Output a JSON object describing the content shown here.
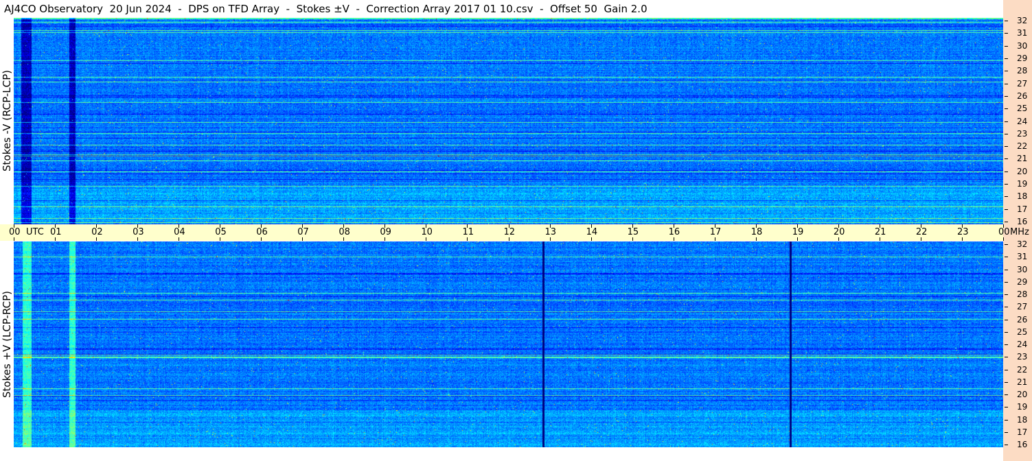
{
  "title": "AJ4CO Observatory  20 Jun 2024  -  DPS on TFD Array  -  Stokes ±V  -  Correction Array 2017 01 10.csv  -  Offset 50  Gain 2.0",
  "panels": {
    "top_label": "Stokes -V (RCP-LCP)",
    "bottom_label": "Stokes +V (LCP-RCP)"
  },
  "time_axis": {
    "utc_label": "UTC",
    "mhz_label": "MHz",
    "hours": [
      "00",
      "01",
      "02",
      "03",
      "04",
      "05",
      "06",
      "07",
      "08",
      "09",
      "10",
      "11",
      "12",
      "13",
      "14",
      "15",
      "16",
      "17",
      "18",
      "19",
      "20",
      "21",
      "22",
      "23",
      "00"
    ]
  },
  "freq_axis": {
    "ticks": [
      "32",
      "31",
      "30",
      "29",
      "28",
      "27",
      "26",
      "25",
      "24",
      "23",
      "22",
      "21",
      "20",
      "19",
      "18",
      "17",
      "16"
    ]
  },
  "colors": {
    "background_blue": "#1f5fe6",
    "axis_band": "#ffffcc",
    "right_strip": "#fcdcc4",
    "title_bg": "#ffffff"
  },
  "chart_data": [
    {
      "type": "heatmap",
      "title": "Stokes -V (RCP-LCP)",
      "xlabel": "UTC",
      "ylabel": "MHz",
      "xlim": [
        0,
        24
      ],
      "ylim": [
        16,
        32
      ],
      "x_tick_labels": [
        "00",
        "01",
        "02",
        "03",
        "04",
        "05",
        "06",
        "07",
        "08",
        "09",
        "10",
        "11",
        "12",
        "13",
        "14",
        "15",
        "16",
        "17",
        "18",
        "19",
        "20",
        "21",
        "22",
        "23",
        "00"
      ],
      "y_tick_labels": [
        "32",
        "31",
        "30",
        "29",
        "28",
        "27",
        "26",
        "25",
        "24",
        "23",
        "22",
        "21",
        "20",
        "19",
        "18",
        "17",
        "16"
      ],
      "colormap": "jet"
    },
    {
      "type": "heatmap",
      "title": "Stokes +V (LCP-RCP)",
      "xlabel": "UTC",
      "ylabel": "MHz",
      "xlim": [
        0,
        24
      ],
      "ylim": [
        16,
        32
      ],
      "x_tick_labels": [
        "00",
        "01",
        "02",
        "03",
        "04",
        "05",
        "06",
        "07",
        "08",
        "09",
        "10",
        "11",
        "12",
        "13",
        "14",
        "15",
        "16",
        "17",
        "18",
        "19",
        "20",
        "21",
        "22",
        "23",
        "00"
      ],
      "y_tick_labels": [
        "32",
        "31",
        "30",
        "29",
        "28",
        "27",
        "26",
        "25",
        "24",
        "23",
        "22",
        "21",
        "20",
        "19",
        "18",
        "17",
        "16"
      ],
      "colormap": "jet"
    }
  ]
}
